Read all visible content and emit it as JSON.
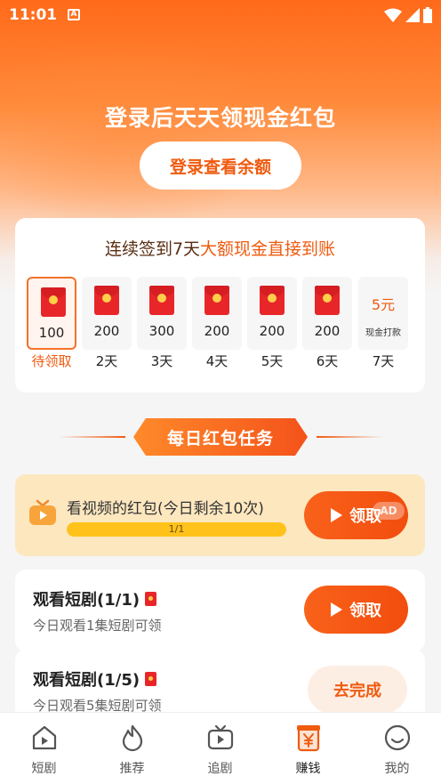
{
  "status_bar": {
    "time": "11:01",
    "a_badge": "A"
  },
  "hero": {
    "title": "登录后天天领现金红包",
    "login_button": "登录查看余额"
  },
  "checkin": {
    "title_prefix": "连续签到7天",
    "title_highlight": "大额现金直接到账",
    "days": [
      {
        "amount": "100",
        "label": "待领取",
        "active": true
      },
      {
        "amount": "200",
        "label": "2天"
      },
      {
        "amount": "300",
        "label": "3天"
      },
      {
        "amount": "200",
        "label": "4天"
      },
      {
        "amount": "200",
        "label": "5天"
      },
      {
        "amount": "200",
        "label": "6天"
      },
      {
        "amount": "5元",
        "note": "现金打款",
        "label": "7天"
      }
    ]
  },
  "section": {
    "title": "每日红包任务"
  },
  "tasks": {
    "video": {
      "title": "看视频的红包(今日剩余10次)",
      "progress_text": "1/1",
      "progress": 1.0,
      "button": "领取",
      "ad_tag": "AD"
    },
    "drama1": {
      "title": "观看短剧(1/1)",
      "subtitle": "今日观看1集短剧可领",
      "button": "领取"
    },
    "drama5": {
      "title": "观看短剧(1/5)",
      "subtitle": "今日观看5集短剧可领",
      "button": "去完成"
    }
  },
  "tabbar": {
    "items": [
      {
        "label": "短剧",
        "icon": "home-play-icon"
      },
      {
        "label": "推荐",
        "icon": "flame-icon"
      },
      {
        "label": "追剧",
        "icon": "tv-icon"
      },
      {
        "label": "赚钱",
        "icon": "yuan-icon",
        "active": true
      },
      {
        "label": "我的",
        "icon": "smile-icon"
      }
    ]
  },
  "colors": {
    "accent": "#ef5b10",
    "envelope": "#e8262a",
    "video_card_bg": "#fde7bf"
  }
}
